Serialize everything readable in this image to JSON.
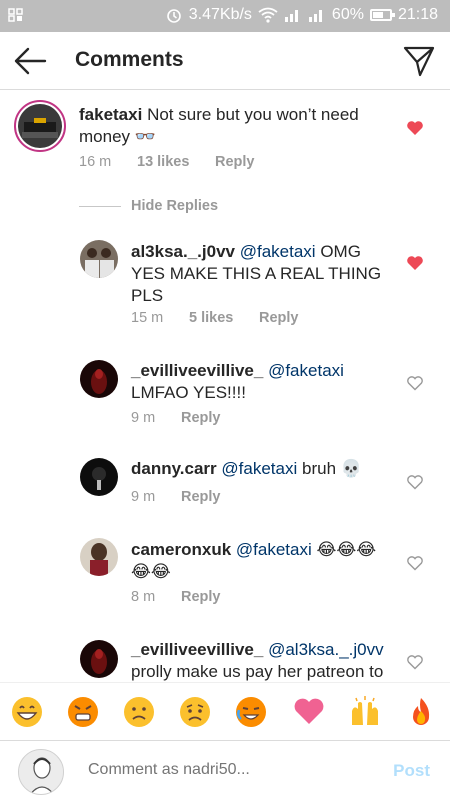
{
  "status_bar": {
    "speed": "3.47Kb/s",
    "battery": "60%",
    "time": "21:18"
  },
  "header": {
    "title": "Comments"
  },
  "comments": [
    {
      "user": "faketaxi",
      "mention": "",
      "text": "Not sure but you won’t need",
      "text2": "money 👓",
      "time": "16 m",
      "likes": "13 likes",
      "reply": "Reply",
      "liked": true
    },
    {
      "user": "al3ksa._.j0vv",
      "mention": "@faketaxi",
      "text": "OMG",
      "text2": "YES MAKE THIS A REAL THING",
      "text3": "PLS",
      "time": "15 m",
      "likes": "5 likes",
      "reply": "Reply",
      "liked": true
    },
    {
      "user": "_evilliveevillive_",
      "mention": "@faketaxi",
      "text": "",
      "text2": "LMFAO YES!!!!",
      "time": "9 m",
      "reply": "Reply",
      "liked": false
    },
    {
      "user": "danny.carr",
      "mention": "@faketaxi",
      "text": "bruh 💀",
      "time": "9 m",
      "reply": "Reply",
      "liked": false
    },
    {
      "user": "cameronxuk",
      "mention": "@faketaxi",
      "text": "😂😂😂",
      "text2": "😂😂",
      "time": "8 m",
      "reply": "Reply",
      "liked": false
    },
    {
      "user": "_evilliveevillive_",
      "mention": "@al3ksa._.j0vv",
      "text": "",
      "text2": "prolly make us pay her patreon to",
      "liked": false
    }
  ],
  "hide_replies": "Hide Replies",
  "emojis": [
    "grinning-face",
    "angry-face",
    "frowning-face",
    "worried-face",
    "crying-face",
    "heart",
    "raised-hands",
    "fire"
  ],
  "input": {
    "placeholder": "Comment as nadri50...",
    "post_label": "Post"
  },
  "colors": {
    "heart": "#ed4956",
    "mention": "#003569",
    "post": "#b2dffc"
  }
}
